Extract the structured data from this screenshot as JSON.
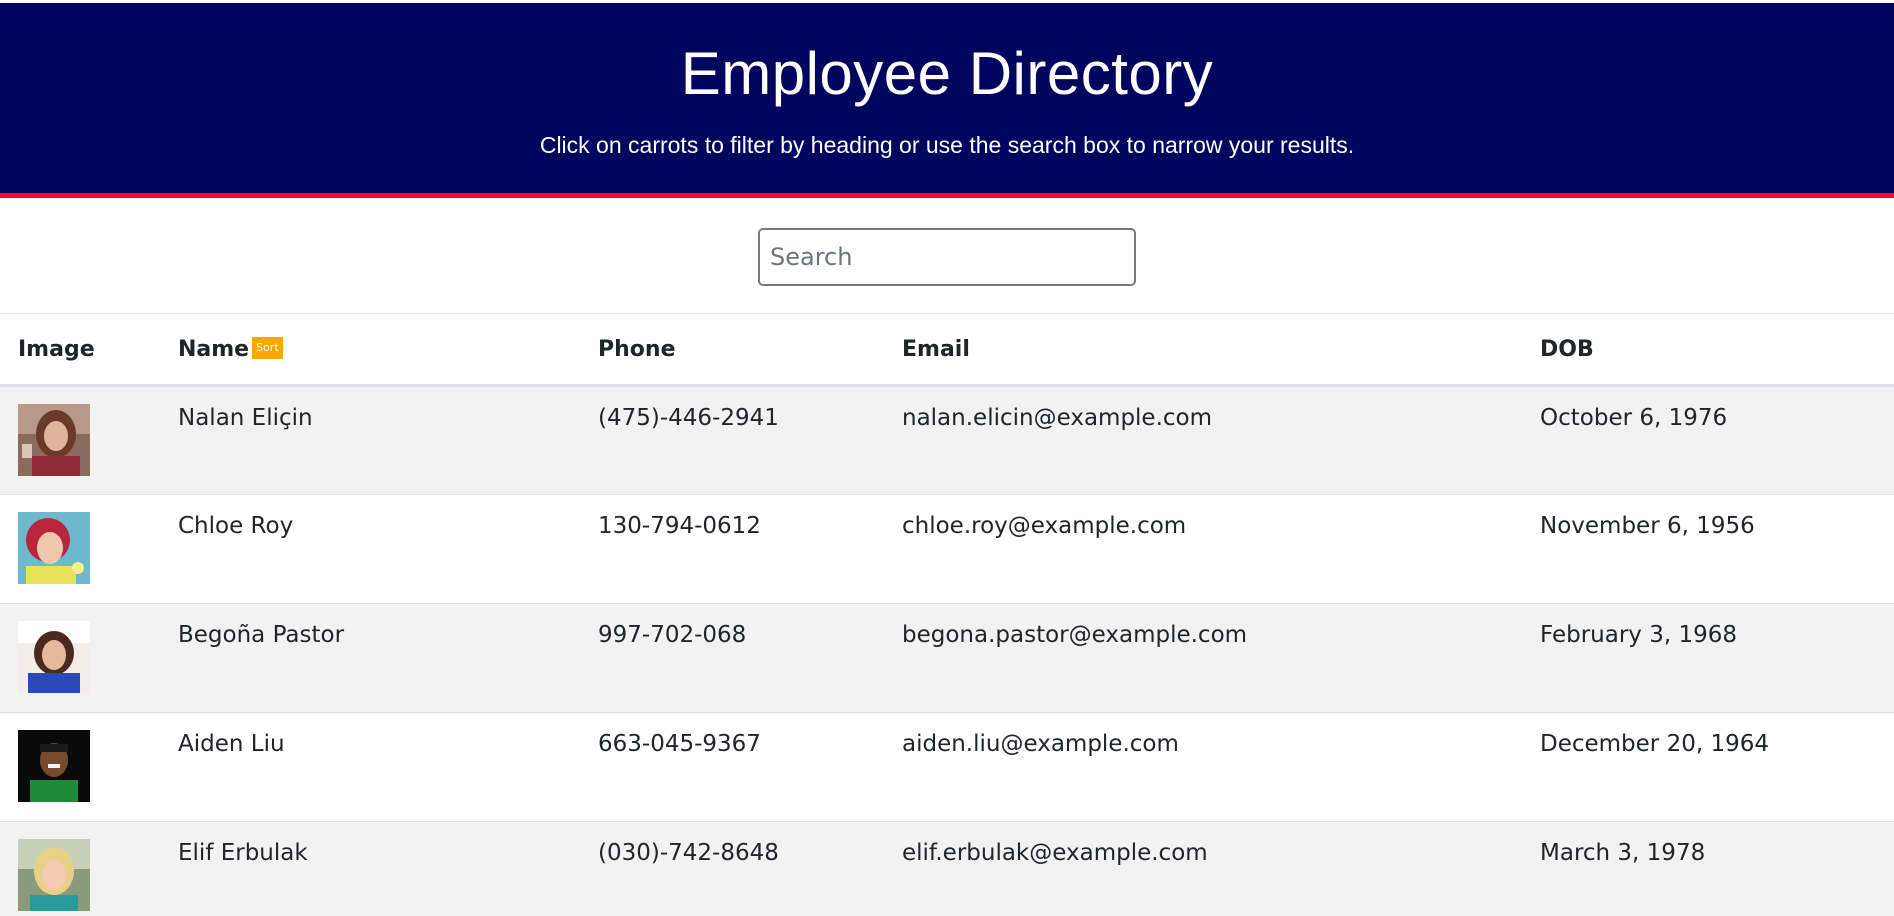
{
  "header": {
    "title": "Employee Directory",
    "subtitle": "Click on carrots to filter by heading or use the search box to narrow your results."
  },
  "search": {
    "placeholder": "Search",
    "value": ""
  },
  "table": {
    "columns": {
      "image": "Image",
      "name": "Name",
      "phone": "Phone",
      "email": "Email",
      "dob": "DOB"
    },
    "sort_label": "Sort",
    "rows": [
      {
        "name": "Nalan Eliçin",
        "phone": "(475)-446-2941",
        "email": "nalan.elicin@example.com",
        "dob": "October 6, 1976"
      },
      {
        "name": "Chloe Roy",
        "phone": "130-794-0612",
        "email": "chloe.roy@example.com",
        "dob": "November 6, 1956"
      },
      {
        "name": "Begoña Pastor",
        "phone": "997-702-068",
        "email": "begona.pastor@example.com",
        "dob": "February 3, 1968"
      },
      {
        "name": "Aiden Liu",
        "phone": "663-045-9367",
        "email": "aiden.liu@example.com",
        "dob": "December 20, 1964"
      },
      {
        "name": "Elif Erbulak",
        "phone": "(030)-742-8648",
        "email": "elif.erbulak@example.com",
        "dob": "March 3, 1978"
      }
    ]
  },
  "colors": {
    "banner_bg": "#02055d",
    "banner_border": "#ff0a1a",
    "sort_button": "#ffa500",
    "row_stripe": "#f2f2f2"
  }
}
